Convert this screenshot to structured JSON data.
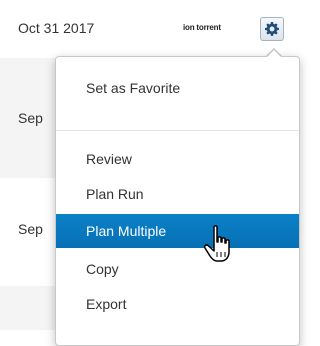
{
  "table": {
    "row1_date": "Oct 31 2017",
    "row1_platform": "ion torrent",
    "row2_date_partial": "Sep",
    "row3_date_partial": "Sep"
  },
  "menu": {
    "items": [
      {
        "label": "Set as Favorite"
      },
      {
        "label": "Review"
      },
      {
        "label": "Plan Run"
      },
      {
        "label": "Plan Multiple",
        "highlighted": true
      },
      {
        "label": "Copy"
      },
      {
        "label": "Export"
      }
    ]
  },
  "icons": {
    "settings": "gear-icon",
    "pointer": "hand-cursor-icon"
  },
  "colors": {
    "highlight": "#0a7cc1",
    "row_alt": "#f4f4f4"
  }
}
